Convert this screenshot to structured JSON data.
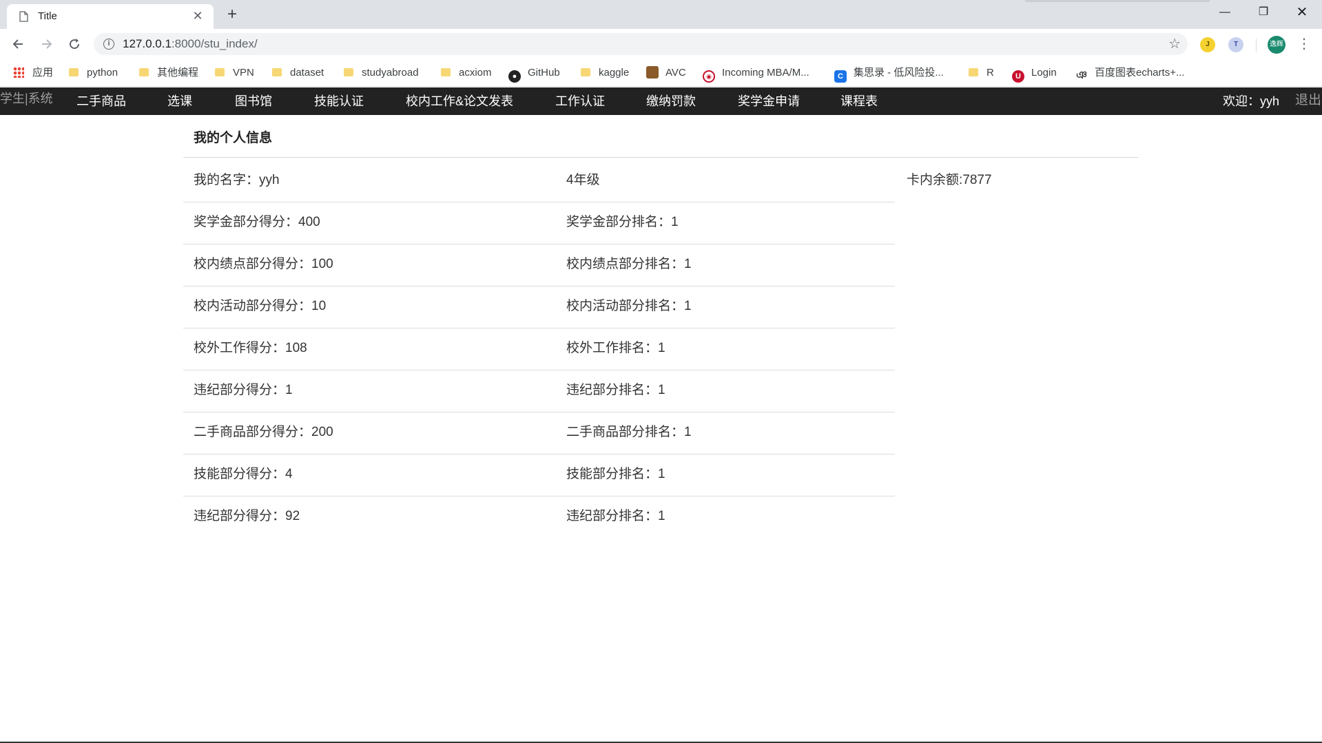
{
  "browser": {
    "tab_title": "Title",
    "tab_close": "✕",
    "new_tab": "+",
    "url_host": "127.0.0.1",
    "url_rest": ":8000/stu_index/",
    "window_controls": {
      "minimize": "—",
      "maximize": "❐",
      "close": "✕"
    },
    "extensions": [
      {
        "label": "J",
        "icon": "j-extension-icon"
      },
      {
        "label": "T",
        "icon": "translate-extension-icon"
      }
    ],
    "profile_label": "逸辉",
    "bookmarks": [
      {
        "label": "应用",
        "icon": "apps-grid-icon"
      },
      {
        "label": "python",
        "icon": "folder-icon"
      },
      {
        "label": "其他编程",
        "icon": "folder-icon"
      },
      {
        "label": "VPN",
        "icon": "folder-icon"
      },
      {
        "label": "dataset",
        "icon": "folder-icon"
      },
      {
        "label": "studyabroad",
        "icon": "folder-icon"
      },
      {
        "label": "acxiom",
        "icon": "folder-icon"
      },
      {
        "label": "GitHub",
        "icon": "github-icon"
      },
      {
        "label": "kaggle",
        "icon": "folder-icon"
      },
      {
        "label": "AVC",
        "icon": "avc-icon"
      },
      {
        "label": "Incoming MBA/M...",
        "icon": "incoming-mba-icon"
      },
      {
        "label": "集思录 - 低风险投...",
        "icon": "jisilu-icon"
      },
      {
        "label": "R",
        "icon": "folder-icon"
      },
      {
        "label": "Login",
        "icon": "login-icon"
      },
      {
        "label": "百度图表echarts+...",
        "icon": "echarts-icon"
      }
    ]
  },
  "app_nav": {
    "brand": "学生|系统",
    "links": [
      "二手商品",
      "选课",
      "图书馆",
      "技能认证",
      "校内工作&论文发表",
      "工作认证",
      "缴纳罚款",
      "奖学金申请",
      "课程表"
    ],
    "welcome": "欢迎：yyh",
    "logout": "退出"
  },
  "profile": {
    "title": "我的个人信息",
    "balance": "卡内余额:7877",
    "rows": [
      [
        "我的名字：yyh",
        "4年级"
      ],
      [
        "奖学金部分得分：400",
        "奖学金部分排名：1"
      ],
      [
        "校内绩点部分得分：100",
        "校内绩点部分排名：1"
      ],
      [
        "校内活动部分得分：10",
        "校内活动部分排名：1"
      ],
      [
        "校外工作得分：108",
        "校外工作排名：1"
      ],
      [
        "违纪部分得分：1",
        "违纪部分排名：1"
      ],
      [
        "二手商品部分得分：200",
        "二手商品部分排名：1"
      ],
      [
        "技能部分得分：4",
        "技能部分排名：1"
      ],
      [
        "违纪部分得分：92",
        "违纪部分排名：1"
      ]
    ]
  }
}
